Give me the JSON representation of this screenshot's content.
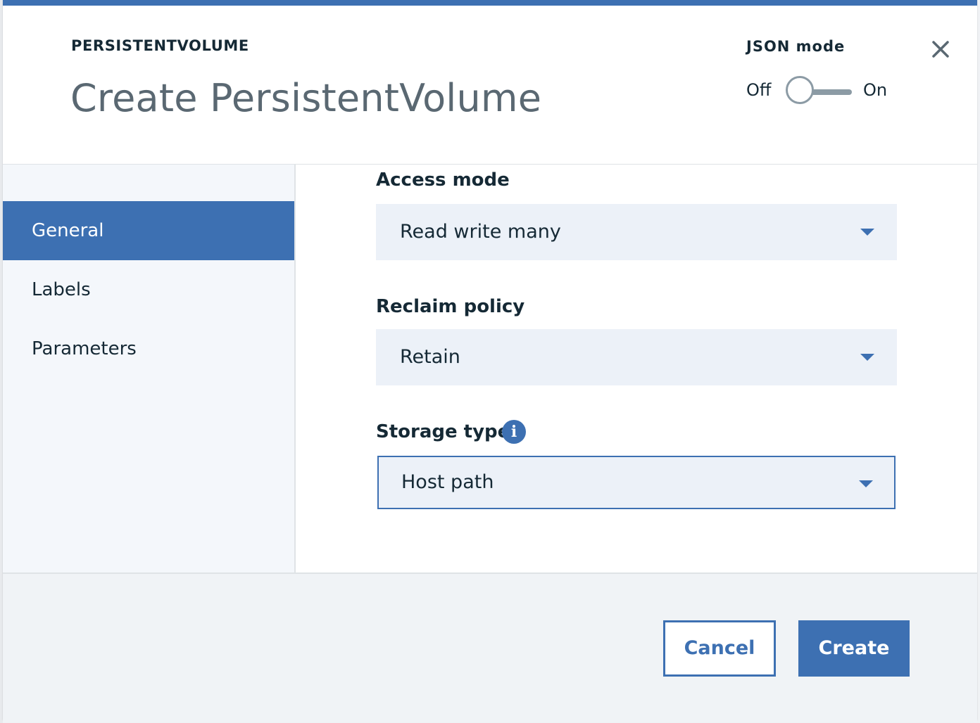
{
  "header": {
    "eyebrow": "PERSISTENTVOLUME",
    "title": "Create PersistentVolume",
    "json_mode": {
      "label": "JSON mode",
      "off_label": "Off",
      "on_label": "On",
      "state": "off"
    }
  },
  "sidebar": {
    "items": [
      {
        "label": "General",
        "active": true
      },
      {
        "label": "Labels",
        "active": false
      },
      {
        "label": "Parameters",
        "active": false
      }
    ]
  },
  "form": {
    "access_mode": {
      "label": "Access mode",
      "value": "Read write many"
    },
    "reclaim_policy": {
      "label": "Reclaim policy",
      "value": "Retain"
    },
    "storage_type": {
      "label": "Storage type",
      "value": "Host path",
      "info_glyph": "i"
    }
  },
  "footer": {
    "cancel_label": "Cancel",
    "create_label": "Create"
  },
  "colors": {
    "accent": "#3d70b2",
    "text": "#152935",
    "muted": "#5a6872",
    "field_bg": "#ecf1f8"
  }
}
